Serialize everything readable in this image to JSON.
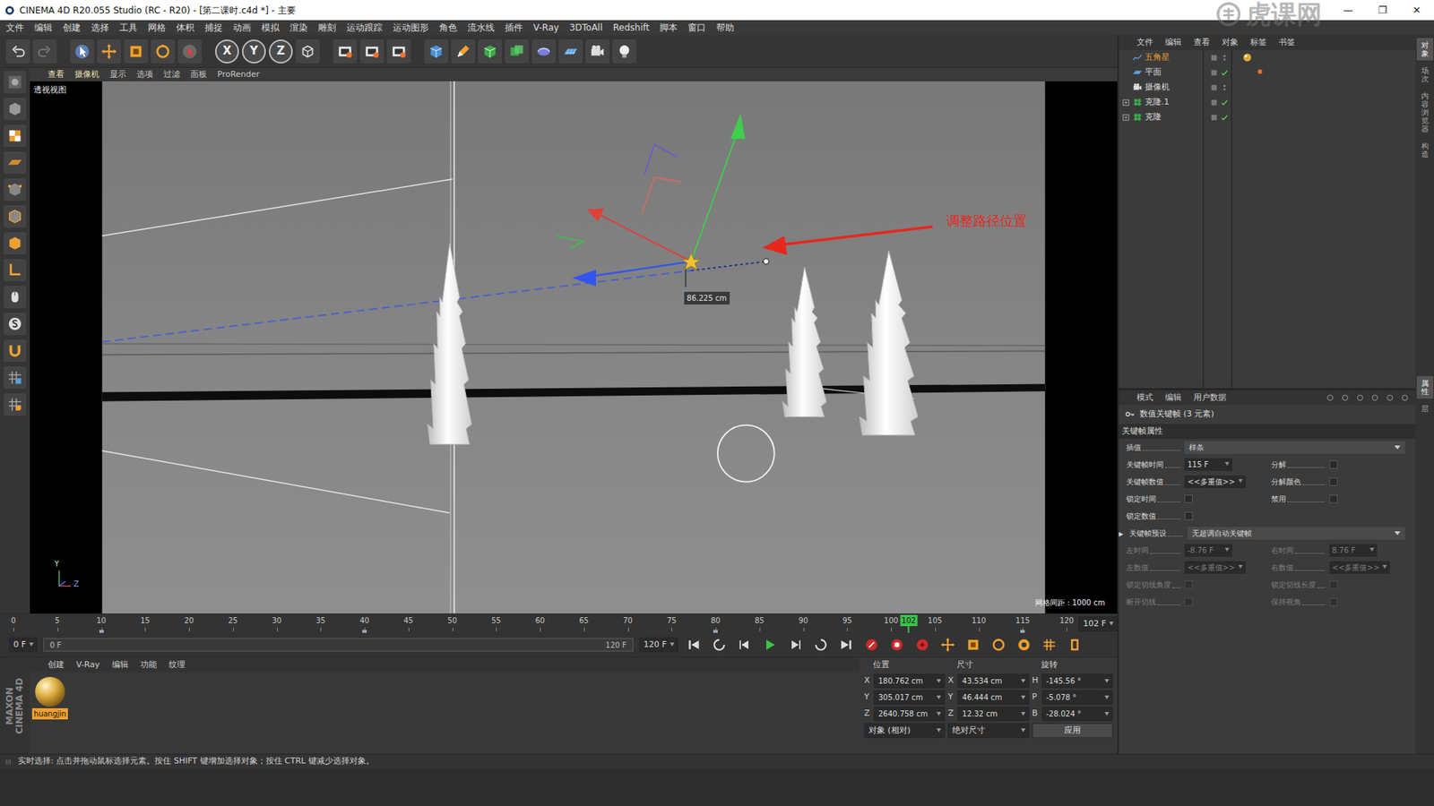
{
  "window": {
    "title": "CINEMA 4D R20.055 Studio (RC - R20) - [第二课时.c4d *] - 主要",
    "controls": [
      "—",
      "❐",
      "✕"
    ]
  },
  "watermark": "虎课网",
  "menu": [
    "文件",
    "编辑",
    "创建",
    "选择",
    "工具",
    "网格",
    "体积",
    "捕捉",
    "动画",
    "模拟",
    "渲染",
    "雕刻",
    "运动跟踪",
    "运动图形",
    "角色",
    "流水线",
    "插件",
    "V-Ray",
    "3DToAll",
    "Redshift",
    "脚本",
    "窗口",
    "帮助"
  ],
  "toolbar": {
    "axis_buttons": [
      "X",
      "Y",
      "Z"
    ]
  },
  "viewport": {
    "menu": [
      "查看",
      "摄像机",
      "显示",
      "选项",
      "过滤",
      "面板",
      "ProRender"
    ],
    "label": "透视视图",
    "annotation": "调整路径位置",
    "measurement": "86.225 cm",
    "grid_spacing": "网格间距 : 1000 cm",
    "axes": [
      "Y",
      "Z"
    ]
  },
  "object_manager": {
    "menu": [
      "文件",
      "编辑",
      "查看",
      "对象",
      "标签",
      "书签"
    ],
    "objects": [
      {
        "name": "五角星",
        "kind": "spline",
        "selected": true,
        "expandable": false,
        "enabled": false,
        "material_tag": true,
        "tag": false
      },
      {
        "name": "平面",
        "kind": "plane",
        "selected": false,
        "expandable": false,
        "enabled": true,
        "material_tag": false,
        "tag": true
      },
      {
        "name": "摄像机",
        "kind": "camera",
        "selected": false,
        "expandable": false,
        "enabled": false,
        "material_tag": false,
        "tag": false
      },
      {
        "name": "克隆.1",
        "kind": "cloner",
        "selected": false,
        "expandable": true,
        "enabled": true,
        "material_tag": false,
        "tag": false
      },
      {
        "name": "克隆",
        "kind": "cloner",
        "selected": false,
        "expandable": true,
        "enabled": true,
        "material_tag": false,
        "tag": false
      }
    ]
  },
  "attributes": {
    "menu": [
      "模式",
      "编辑",
      "用户数据"
    ],
    "title": "数值关键帧 (3 元素)",
    "section": "关键帧属性",
    "rows": [
      [
        {
          "label": "插值",
          "kind": "select",
          "value": "样条",
          "disabled": false
        }
      ],
      [
        {
          "label": "关键帧时间",
          "kind": "field",
          "value": "115 F",
          "disabled": false
        },
        {
          "label": "分解",
          "kind": "checkbox",
          "checked": false,
          "disabled": false
        }
      ],
      [
        {
          "label": "关键帧数值",
          "kind": "field",
          "value": "<<多重值>>",
          "disabled": false
        },
        {
          "label": "分解颜色",
          "kind": "checkbox",
          "checked": false,
          "disabled": false
        }
      ],
      [
        {
          "label": "锁定时间",
          "kind": "checkbox",
          "checked": false,
          "disabled": false
        },
        {
          "label": "禁用",
          "kind": "checkbox",
          "checked": false,
          "disabled": false
        }
      ],
      [
        {
          "label": "锁定数值",
          "kind": "checkbox",
          "checked": false,
          "disabled": false
        }
      ],
      [
        {
          "label": "关键帧预设",
          "kind": "select",
          "value": "无超调自动关键帧",
          "disabled": false,
          "expander": "▸"
        }
      ],
      [
        {
          "label": "左时间",
          "kind": "field",
          "value": "-8.76 F",
          "disabled": true
        },
        {
          "label": "右时间",
          "kind": "field",
          "value": "8.76 F",
          "disabled": true
        }
      ],
      [
        {
          "label": "左数值",
          "kind": "field",
          "value": "<<多重值>>",
          "disabled": true
        },
        {
          "label": "右数值",
          "kind": "field",
          "value": "<<多重值>>",
          "disabled": true
        }
      ],
      [
        {
          "label": "锁定切线角度",
          "kind": "checkbox",
          "checked": false,
          "disabled": true
        },
        {
          "label": "锁定切线长度",
          "kind": "checkbox",
          "checked": false,
          "disabled": true
        }
      ],
      [
        {
          "label": "断开切线",
          "kind": "checkbox",
          "checked": false,
          "disabled": true
        },
        {
          "label": "保持视角",
          "kind": "checkbox",
          "checked": false,
          "disabled": true
        }
      ]
    ]
  },
  "side_tabs_top": [
    {
      "label": "对象",
      "selected": true
    },
    {
      "label": "场次",
      "selected": false
    },
    {
      "label": "内容浏览器",
      "selected": false
    },
    {
      "label": "构造",
      "selected": false
    }
  ],
  "side_tabs_bottom": [
    {
      "label": "属性",
      "selected": true
    },
    {
      "label": "层",
      "selected": false
    }
  ],
  "timeline": {
    "ticks": [
      "0",
      "5",
      "10",
      "15",
      "20",
      "25",
      "30",
      "35",
      "40",
      "45",
      "50",
      "55",
      "60",
      "65",
      "70",
      "75",
      "80",
      "85",
      "90",
      "95",
      "100",
      "105",
      "110",
      "115",
      "120"
    ],
    "current": "102",
    "level": 0.85,
    "keyframes": [
      10,
      40,
      80,
      115
    ],
    "current_frame": "102 F",
    "start": "0 F",
    "range_from": "0 F",
    "range_to": "120 F",
    "end": "120 F",
    "range_level": 1
  },
  "materials": {
    "menu": [
      "创建",
      "V-Ray",
      "编辑",
      "功能",
      "纹理"
    ],
    "items": [
      {
        "name": "huangjin",
        "selected": true
      }
    ]
  },
  "coordinates": {
    "headers": [
      "位置",
      "尺寸",
      "旋转"
    ],
    "rows": [
      {
        "pos_axis": "X",
        "position": "180.762 cm",
        "size_axis": "X",
        "size": "43.534 cm",
        "rot_axis": "H",
        "rotation": "-145.56 °"
      },
      {
        "pos_axis": "Y",
        "position": "305.017 cm",
        "size_axis": "Y",
        "size": "46.444 cm",
        "rot_axis": "P",
        "rotation": "-5.078 °"
      },
      {
        "pos_axis": "Z",
        "position": "2640.758 cm",
        "size_axis": "Z",
        "size": "12.32 cm",
        "rot_axis": "B",
        "rotation": "-28.024 °"
      }
    ],
    "modes": [
      "对象 (相对)",
      "绝对尺寸"
    ],
    "apply": "应用"
  },
  "logo": [
    "MAXON",
    "CINEMA 4D"
  ],
  "status_bar": "实时选择: 点击并拖动鼠标选择元素。按住 SHIFT 键增加选择对象；按住 CTRL 键减少选择对象。"
}
